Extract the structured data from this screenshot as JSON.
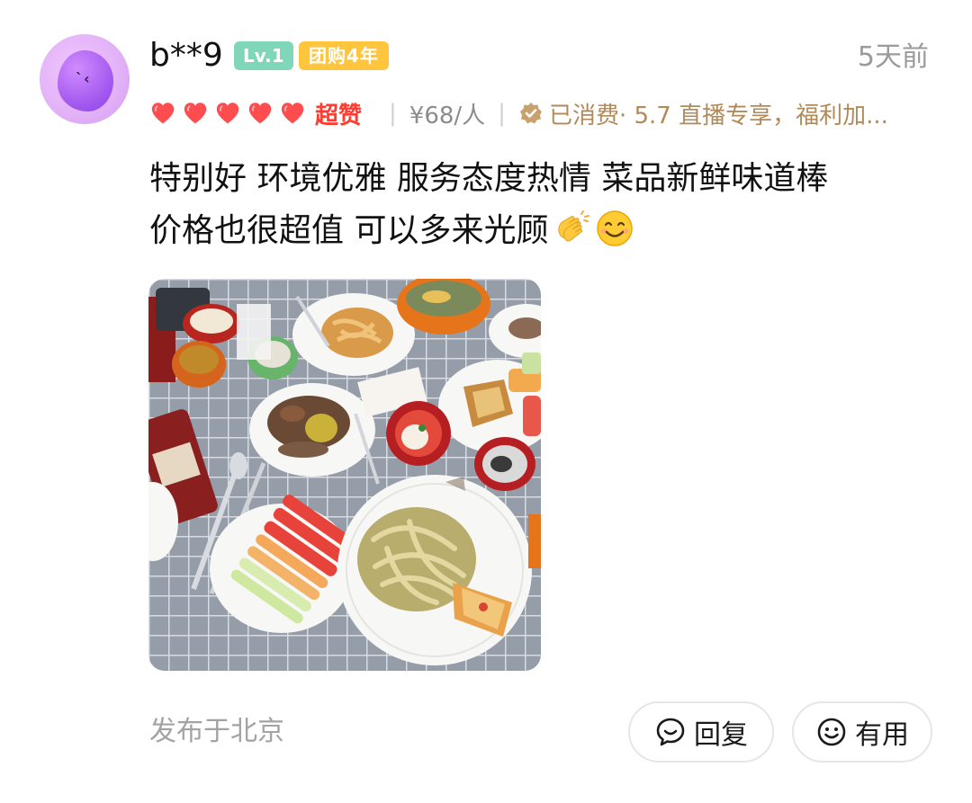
{
  "review": {
    "username": "b**9",
    "level_badge": "Lv.1",
    "group_badge": "团购4年",
    "timestamp": "5天前",
    "rating_count": 5,
    "rating_label": "超赞",
    "price": "¥68/人",
    "consumed_label": "已消费",
    "consumed_detail": "· 5.7 直播专享，福利加...",
    "text_line1": "特别好 环境优雅 服务态度热情 菜品新鲜味道棒",
    "text_line2": "价格也很超值 可以多来光顾",
    "location": "发布于北京",
    "reply_label": "回复",
    "useful_label": "有用"
  },
  "colors": {
    "heart": "#ff4d4f",
    "rating_label": "#ff3b30",
    "level_badge_bg": "#7fd6b8",
    "group_badge_bg": "#ffc53d",
    "consumed": "#b28a5a",
    "muted_text": "#9a9a9a"
  },
  "icons": {
    "avatar": "purple-blob-avatar",
    "heart": "heart-icon",
    "verified": "verified-badge-icon",
    "emoji_clap": "clapping-hands-emoji",
    "emoji_smile": "smiling-face-emoji",
    "reply": "chat-bubble-icon",
    "useful": "smiley-icon"
  }
}
